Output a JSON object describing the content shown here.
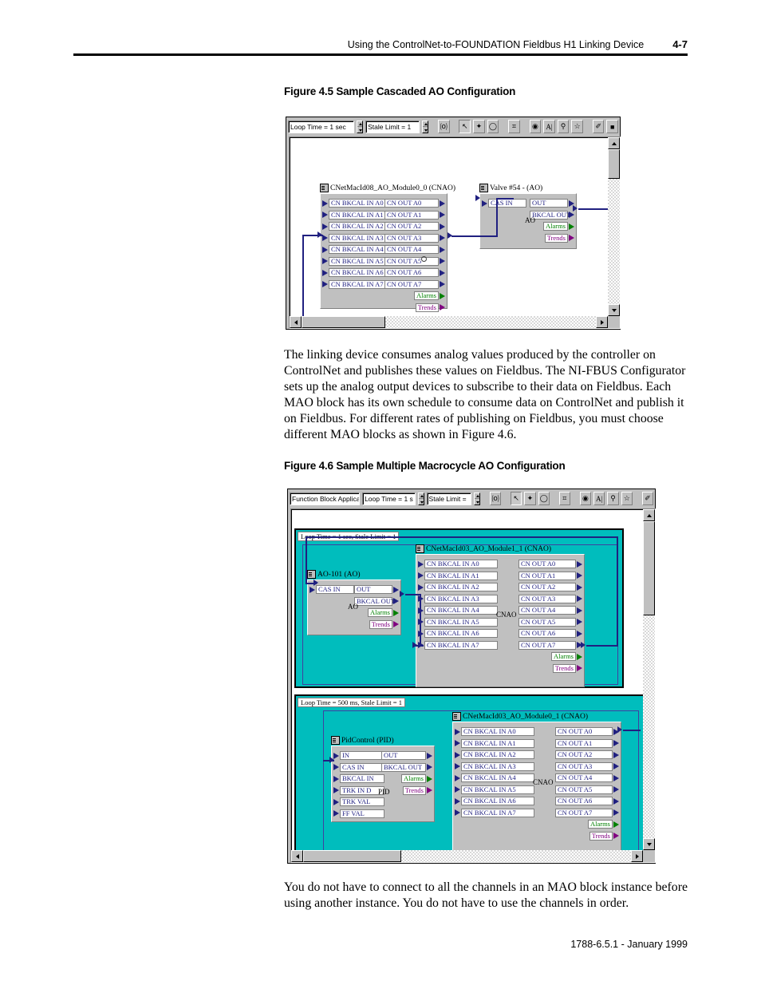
{
  "header": {
    "title": "Using the ControlNet-to-FOUNDATION Fieldbus H1 Linking Device",
    "page_number": "4-7"
  },
  "figure45": {
    "caption": "Figure 4.5 Sample Cascaded AO Configuration",
    "toolbar": {
      "loop_time": "Loop Time = 1 sec",
      "stale_limit": "Stale Limit = 1",
      "buttons": [
        {
          "name": "block-info-icon",
          "glyph": "⒪"
        },
        {
          "name": "pointer-tool-icon",
          "glyph": "↖"
        },
        {
          "name": "connect-tool-icon",
          "glyph": "✦"
        },
        {
          "name": "ellipse-tool-icon",
          "glyph": "◯"
        },
        {
          "name": "block-palette-icon",
          "glyph": "⌗"
        },
        {
          "name": "highlight-icon",
          "glyph": "◉"
        },
        {
          "name": "text-tool-icon",
          "glyph": "A|"
        },
        {
          "name": "zoom-icon",
          "glyph": "⚲"
        },
        {
          "name": "up-level-icon",
          "glyph": "☆"
        },
        {
          "name": "fill-color-icon",
          "glyph": "✐"
        },
        {
          "name": "color-swatch-icon",
          "glyph": "■"
        }
      ]
    },
    "blocks": [
      {
        "id": "cnao-module0-0",
        "title": "CNetMacId08_AO_Module0_0 (CNAO)",
        "inputs": [
          "CN BKCAL IN A0",
          "CN BKCAL IN A1",
          "CN BKCAL IN A2",
          "CN BKCAL IN A3",
          "CN BKCAL IN A4",
          "CN BKCAL IN A5",
          "CN BKCAL IN A6",
          "CN BKCAL IN A7"
        ],
        "outputs": [
          "CN OUT A0",
          "CN OUT A1",
          "CN OUT A2",
          "CN OUT A3",
          "CN OUT A4",
          "CN OUT A5",
          "CN OUT A6",
          "CN OUT A7"
        ],
        "alarms": "Alarms",
        "trends": "Trends"
      },
      {
        "id": "valve-54",
        "title": "Valve #54 - (AO)",
        "inputs": [
          "CAS IN"
        ],
        "outputs": [
          "OUT",
          "BKCAL OUT"
        ],
        "mid_label": "AO",
        "alarms": "Alarms",
        "trends": "Trends"
      }
    ]
  },
  "paragraph1": "The linking device consumes analog values produced by the controller on ControlNet and publishes these values on Fieldbus. The NI-FBUS Configurator sets up the analog output devices to subscribe to their data on Fieldbus. Each MAO block has its own schedule to consume data on ControlNet and publish it on Fieldbus. For different rates of publishing on Fieldbus, you must choose different MAO blocks as shown in Figure 4.6.",
  "figure46": {
    "caption": "Figure 4.6 Sample Multiple Macrocycle AO Configuration",
    "toolbar": {
      "application": "Function Block Applicati",
      "loop_time": "Loop Time = 1 s",
      "stale_limit": "Stale Limit =",
      "buttons": [
        {
          "name": "block-info-icon",
          "glyph": "⒪"
        },
        {
          "name": "pointer-tool-icon",
          "glyph": "↖"
        },
        {
          "name": "connect-tool-icon",
          "glyph": "✦"
        },
        {
          "name": "ellipse-tool-icon",
          "glyph": "◯"
        },
        {
          "name": "block-palette-icon",
          "glyph": "⌗"
        },
        {
          "name": "highlight-icon",
          "glyph": "◉"
        },
        {
          "name": "text-tool-icon",
          "glyph": "A|"
        },
        {
          "name": "zoom-icon",
          "glyph": "⚲"
        },
        {
          "name": "up-level-icon",
          "glyph": "☆"
        },
        {
          "name": "fill-color-icon",
          "glyph": "✐"
        }
      ]
    },
    "macrocycle_top": {
      "header": "Loop Time = 1 sec, Stale Limit = 1",
      "blocks": [
        {
          "id": "ao-101",
          "title": "AO-101 (AO)",
          "inputs": [
            "CAS IN"
          ],
          "outputs": [
            "OUT",
            "BKCAL OUT"
          ],
          "mid_label": "AO",
          "alarms": "Alarms",
          "trends": "Trends"
        },
        {
          "id": "cnao-module1-1",
          "title": "CNetMacId03_AO_Module1_1 (CNAO)",
          "inputs": [
            "CN BKCAL IN A0",
            "CN BKCAL IN A1",
            "CN BKCAL IN A2",
            "CN BKCAL IN A3",
            "CN BKCAL IN A4",
            "CN BKCAL IN A5",
            "CN BKCAL IN A6",
            "CN BKCAL IN A7"
          ],
          "outputs": [
            "CN OUT A0",
            "CN OUT A1",
            "CN OUT A2",
            "CN OUT A3",
            "CN OUT A4",
            "CN OUT A5",
            "CN OUT A6",
            "CN OUT A7"
          ],
          "mid_label": "CNAO",
          "alarms": "Alarms",
          "trends": "Trends"
        }
      ]
    },
    "macrocycle_bottom": {
      "header": "Loop Time = 500 ms, Stale Limit = 1",
      "blocks": [
        {
          "id": "pid-control",
          "title": "PidControl (PID)",
          "inputs": [
            "IN",
            "CAS IN",
            "BKCAL IN",
            "TRK IN D",
            "TRK VAL",
            "FF VAL"
          ],
          "outputs": [
            "OUT",
            "BKCAL OUT"
          ],
          "mid_label": "PID",
          "alarms": "Alarms",
          "trends": "Trends"
        },
        {
          "id": "cnao-module0-1",
          "title": "CNetMacId03_AO_Module0_1 (CNAO)",
          "inputs": [
            "CN BKCAL IN A0",
            "CN BKCAL IN A1",
            "CN BKCAL IN A2",
            "CN BKCAL IN A3",
            "CN BKCAL IN A4",
            "CN BKCAL IN A5",
            "CN BKCAL IN A6",
            "CN BKCAL IN A7"
          ],
          "outputs": [
            "CN OUT A0",
            "CN OUT A1",
            "CN OUT A2",
            "CN OUT A3",
            "CN OUT A4",
            "CN OUT A5",
            "CN OUT A6",
            "CN OUT A7"
          ],
          "mid_label": "CNAO",
          "alarms": "Alarms",
          "trends": "Trends"
        }
      ]
    }
  },
  "paragraph2": "You do not have to connect to all the channels in an MAO block instance before using another instance. You do not have to use the channels in order.",
  "footer": "1788-6.5.1 - January 1999",
  "colors": {
    "macrocycle_teal": "#00bdbd",
    "wire": "#202080",
    "block_face": "#c0c0c0",
    "alarm_green": "#008000",
    "trend_purple": "#800080"
  }
}
